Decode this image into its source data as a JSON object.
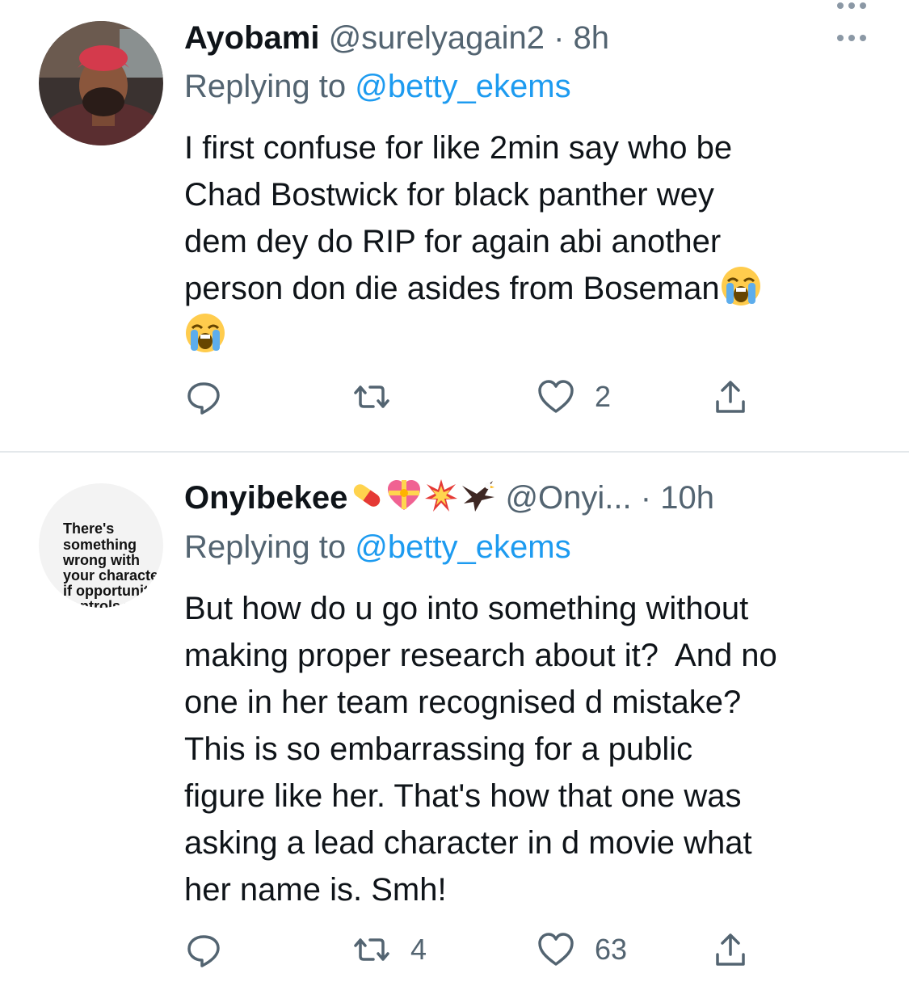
{
  "tweets": [
    {
      "display_name": "Ayobami",
      "handle": "@surelyagain2",
      "sep": " · ",
      "time": "8h",
      "replying_prefix": "Replying to ",
      "replying_to": "@betty_ekems",
      "text_line1": "I first confuse for like 2min say who be",
      "text_line2": "Chad Bostwick for black panther wey",
      "text_line3": "dem dey do RIP for again abi another",
      "text_line4": "person don die asides from Boseman",
      "emojis": [
        "loudly-crying-face",
        "loudly-crying-face"
      ],
      "reply_count": "",
      "retweet_count": "",
      "like_count": "2"
    },
    {
      "display_name": "Onyibekee",
      "name_emojis": [
        "pill",
        "heart-with-ribbon",
        "collision",
        "eagle"
      ],
      "handle": "@Onyi...",
      "sep": " · ",
      "time": "10h",
      "avatar_text": "There's something wrong with your character if opportunity controls your loyalty.",
      "replying_prefix": "Replying to ",
      "replying_to": "@betty_ekems",
      "text": "But how do u go into something without\nmaking proper research about it?  And no\none in her team recognised d mistake?\nThis is so embarrassing for a public\nfigure like her. That's how that one was\nasking a lead character in d movie what\nher name is. Smh!",
      "reply_count": "",
      "retweet_count": "4",
      "like_count": "63"
    }
  ],
  "colors": {
    "text": "#0f1419",
    "secondary": "#536471",
    "link": "#1d9bf0",
    "divider": "#e4e8eb"
  }
}
